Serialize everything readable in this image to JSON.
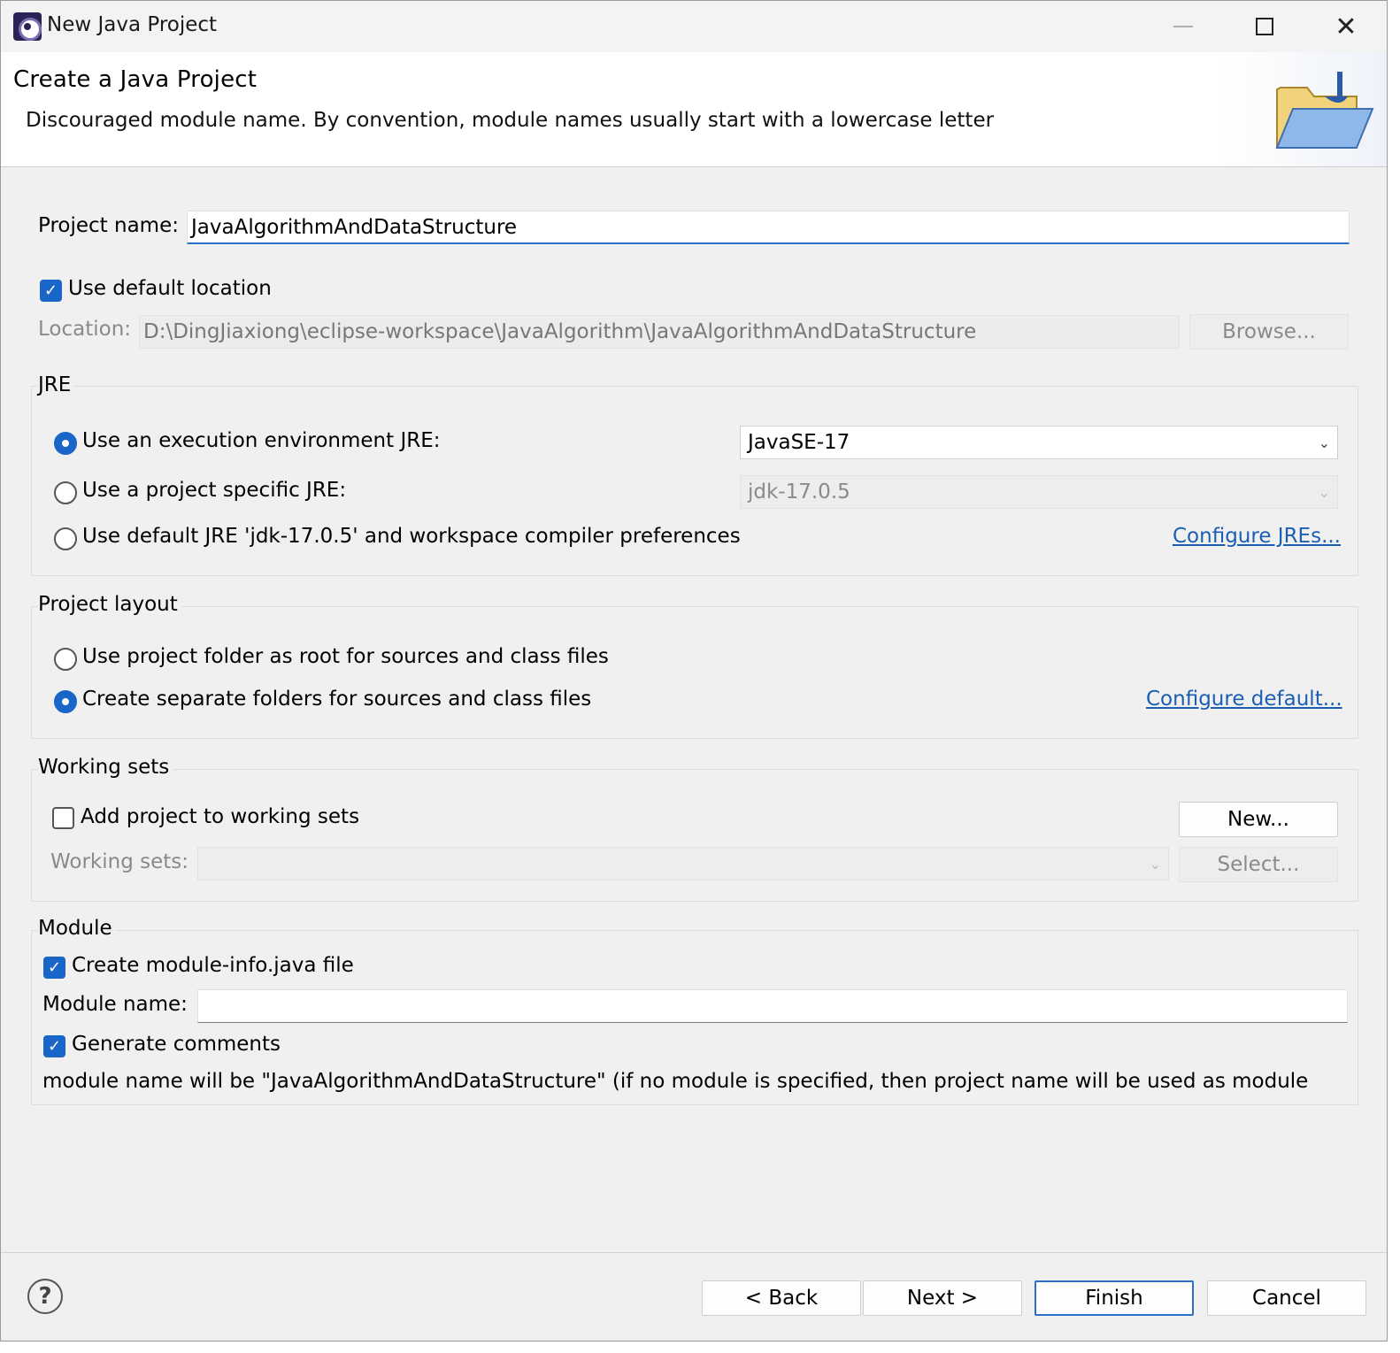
{
  "window": {
    "title": "New Java Project"
  },
  "banner": {
    "title": "Create a Java Project",
    "message": "Discouraged module name. By convention, module names usually start with a lowercase letter"
  },
  "project": {
    "name_label": "Project name:",
    "name_value": "JavaAlgorithmAndDataStructure",
    "use_default_location_label": "Use default location",
    "use_default_location_checked": true,
    "location_label": "Location:",
    "location_value": "D:\\DingJiaxiong\\eclipse-workspace\\JavaAlgorithm\\JavaAlgorithmAndDataStructure",
    "browse_label": "Browse..."
  },
  "jre": {
    "group_title": "JRE",
    "option_execution_env": "Use an execution environment JRE:",
    "execution_env_value": "JavaSE-17",
    "option_project_specific": "Use a project specific JRE:",
    "project_specific_value": "jdk-17.0.5",
    "option_default": "Use default JRE 'jdk-17.0.5' and workspace compiler preferences",
    "configure_link": "Configure JREs..."
  },
  "layout": {
    "group_title": "Project layout",
    "option_root": "Use project folder as root for sources and class files",
    "option_separate": "Create separate folders for sources and class files",
    "configure_link": "Configure default..."
  },
  "working_sets": {
    "group_title": "Working sets",
    "add_label": "Add project to working sets",
    "new_button": "New...",
    "sets_label": "Working sets:",
    "select_button": "Select..."
  },
  "module": {
    "group_title": "Module",
    "create_label": "Create module-info.java file",
    "name_label": "Module name:",
    "name_value": "",
    "comments_label": "Generate comments",
    "info_text": "module name will be \"JavaAlgorithmAndDataStructure\"  (if no module is specified, then project name will be used as module"
  },
  "footer": {
    "help_glyph": "?",
    "back_label": "< Back",
    "next_label": "Next >",
    "finish_label": "Finish",
    "cancel_label": "Cancel"
  },
  "colors": {
    "accent": "#1a66c8",
    "link": "#1a5fb4",
    "dialog_bg": "#f0f0f0"
  },
  "icons": [
    "eclipse-app-icon",
    "minimize-icon",
    "maximize-icon",
    "close-icon",
    "java-project-folder-icon",
    "checkmark-icon",
    "chevron-down-icon",
    "help-icon"
  ]
}
